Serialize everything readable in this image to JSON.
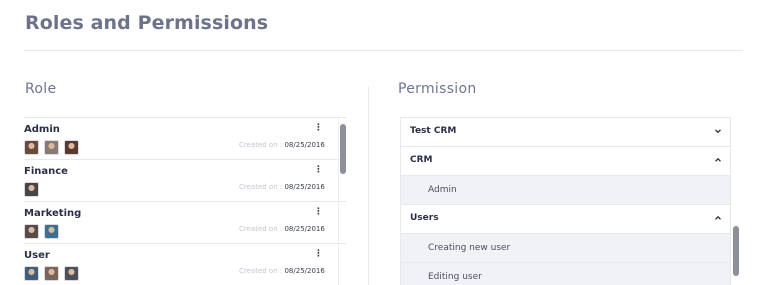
{
  "page": {
    "title": "Roles and Permissions"
  },
  "role_section": {
    "title": "Role",
    "created_prefix": "Created on : ",
    "items": [
      {
        "name": "Admin",
        "created": "08/25/2016",
        "avatars": [
          "#6b4a3a",
          "#8a7a74",
          "#5a3a2e"
        ]
      },
      {
        "name": "Finance",
        "created": "08/25/2016",
        "avatars": [
          "#4a4442"
        ]
      },
      {
        "name": "Marketing",
        "created": "08/25/2016",
        "avatars": [
          "#5b4b46",
          "#3f6f8e"
        ]
      },
      {
        "name": "User",
        "created": "08/25/2016",
        "avatars": [
          "#3e5e7a",
          "#7a6658",
          "#4e5058"
        ]
      }
    ]
  },
  "permission_section": {
    "title": "Permission",
    "rows": [
      {
        "label": "Test CRM",
        "level": 0,
        "chevron": "down"
      },
      {
        "label": "CRM",
        "level": 0,
        "chevron": "up"
      },
      {
        "label": "Admin",
        "level": 1
      },
      {
        "label": "Users",
        "level": 0,
        "chevron": "up"
      },
      {
        "label": "Creating new user",
        "level": 1
      },
      {
        "label": "Editing user",
        "level": 1
      }
    ]
  },
  "icons": {
    "kebab": "kebab-menu-icon",
    "chevron_down": "chevron-down-icon",
    "chevron_up": "chevron-up-icon"
  },
  "colors": {
    "title": "#6d7389",
    "scrollbar": "#8d909a",
    "child_row_bg": "#f1f2f5"
  }
}
